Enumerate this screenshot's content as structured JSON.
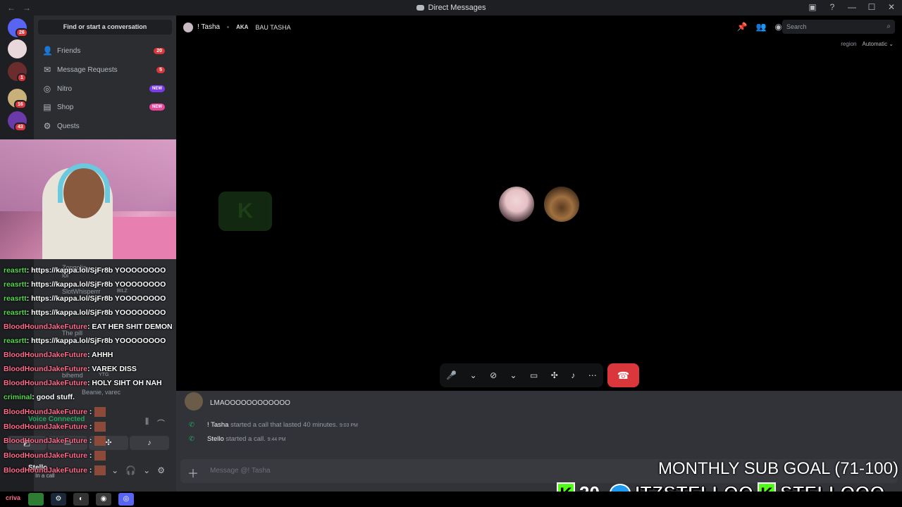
{
  "window": {
    "title": "Direct Messages",
    "nav_back": "←",
    "nav_forward": "→",
    "minimize": "—",
    "maximize": "☐",
    "close": "✕"
  },
  "guilds": {
    "badges": [
      "26",
      "1",
      "16",
      "43"
    ]
  },
  "sidebar": {
    "search_label": "Find or start a conversation",
    "items": [
      {
        "label": "Friends",
        "badge": "20"
      },
      {
        "label": "Message Requests",
        "badge": "5"
      },
      {
        "label": "Nitro",
        "tag": "NEW"
      },
      {
        "label": "Shop",
        "tag": "NEW"
      },
      {
        "label": "Quests"
      }
    ],
    "ghost_names": [
      "Zongolia",
      "lol",
      "SlotWhisperrr",
      "BILZ",
      "The pill",
      "bihemd",
      "YTG",
      "Beanie, varec"
    ]
  },
  "chat_overlay": [
    {
      "user": "reasrtt",
      "color": "green",
      "text": ": https://kappa.lol/SjFr8b YOOOOOOOO"
    },
    {
      "user": "reasrtt",
      "color": "green",
      "text": ": https://kappa.lol/SjFr8b YOOOOOOOO"
    },
    {
      "user": "reasrtt",
      "color": "green",
      "text": ": https://kappa.lol/SjFr8b YOOOOOOOO"
    },
    {
      "user": "reasrtt",
      "color": "green",
      "text": ": https://kappa.lol/SjFr8b YOOOOOOOO"
    },
    {
      "user": "BloodHoundJakeFuture",
      "color": "pink",
      "text": ": EAT HER SHIT DEMON"
    },
    {
      "user": "reasrtt",
      "color": "green",
      "text": ": https://kappa.lol/SjFr8b YOOOOOOOO"
    },
    {
      "user": "BloodHoundJakeFuture",
      "color": "pink",
      "text": ": AHHH"
    },
    {
      "user": "BloodHoundJakeFuture",
      "color": "pink",
      "text": ": VAREK DISS"
    },
    {
      "user": "BloodHoundJakeFuture",
      "color": "pink",
      "text": ": HOLY SIHT OH NAH"
    },
    {
      "user": "criminal",
      "color": "green",
      "text": ": good stuff."
    },
    {
      "user": "BloodHoundJakeFuture",
      "color": "pink",
      "text": " :"
    },
    {
      "user": "BloodHoundJakeFuture",
      "color": "pink",
      "text": " :"
    },
    {
      "user": "BloodHoundJakeFuture",
      "color": "pink",
      "text": " :"
    },
    {
      "user": "BloodHoundJakeFuture",
      "color": "pink",
      "text": " :"
    },
    {
      "user": "BloodHoundJakeFuture",
      "color": "pink",
      "text": " :"
    }
  ],
  "header": {
    "name": "! Tasha",
    "aka": "AKA",
    "alias": "BAU TASHA",
    "search_placeholder": "Search",
    "region_label": "region",
    "region_value": "Automatic ⌄"
  },
  "voice": {
    "status": "Voice Connected",
    "user": "Stello",
    "user_status": "In a call"
  },
  "messages": {
    "top_text": "LMAOOOOOOOOOOOO",
    "system": [
      {
        "name": "! Tasha",
        "text": " started a call that lasted 40 minutes.",
        "time": "9:03 PM"
      },
      {
        "name": "Stello",
        "text": " started a call.",
        "time": "9:44 PM"
      }
    ]
  },
  "composer": {
    "placeholder": "Message @! Tasha"
  },
  "overlay": {
    "sub_goal": "MONTHLY SUB GOAL (71-100)",
    "kick_count": "20",
    "twitter": "ITZSTELLOO",
    "kick_handle": "STELLOOO"
  },
  "taskbar": {
    "label": "criva"
  }
}
